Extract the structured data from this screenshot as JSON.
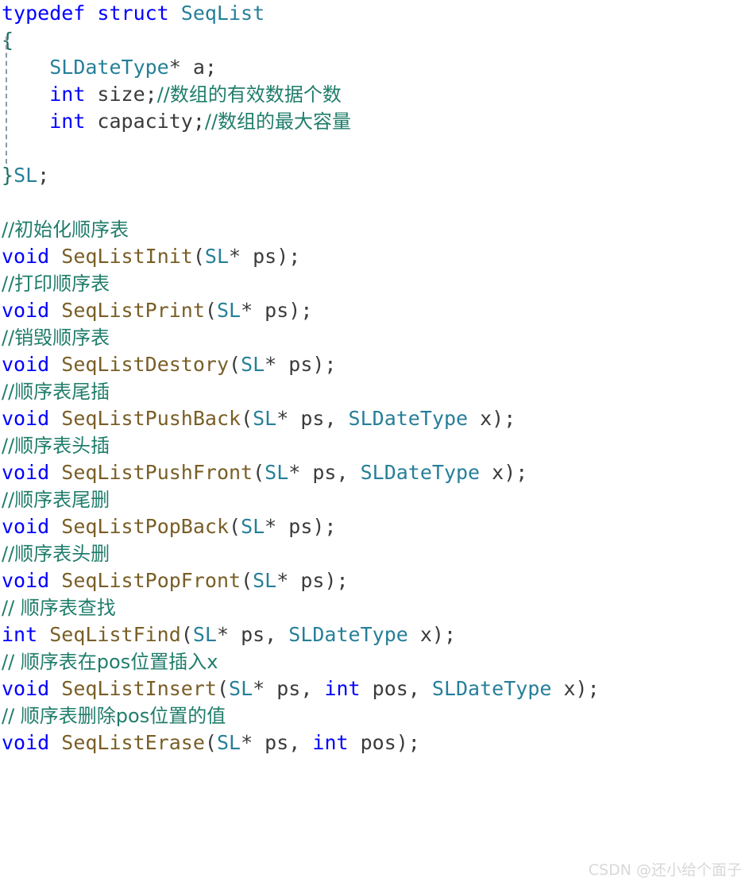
{
  "editor": {
    "language": "c",
    "background": "#ffffff",
    "colors": {
      "keyword": "#0000ff",
      "type": "#267f99",
      "function": "#795e26",
      "comment": "#207d6b",
      "punctuation": "#3b3b3b",
      "indent_guide": "#8a9aa5",
      "watermark": "#d8d8d8"
    },
    "indent_guide_visible": true
  },
  "code": {
    "lines": [
      {
        "id": "line-1",
        "text": "typedef struct SeqList",
        "tokens": [
          {
            "t": "typedef struct ",
            "c": "kw"
          },
          {
            "t": "SeqList",
            "c": "type"
          }
        ]
      },
      {
        "id": "line-2",
        "text": "{",
        "tokens": [
          {
            "t": "{",
            "c": "brace"
          }
        ]
      },
      {
        "id": "line-3",
        "text": "    SLDateType* a;",
        "tokens": [
          {
            "t": "    ",
            "c": "pun"
          },
          {
            "t": "SLDateType",
            "c": "type"
          },
          {
            "t": "* a;",
            "c": "pun"
          }
        ]
      },
      {
        "id": "line-4",
        "text": "    int size;//数组的有效数据个数",
        "tokens": [
          {
            "t": "    ",
            "c": "pun"
          },
          {
            "t": "int",
            "c": "kw"
          },
          {
            "t": " size;",
            "c": "pun"
          },
          {
            "t": "//数组的有效数据个数",
            "c": "cmt cn"
          }
        ]
      },
      {
        "id": "line-5",
        "text": "    int capacity;//数组的最大容量",
        "tokens": [
          {
            "t": "    ",
            "c": "pun"
          },
          {
            "t": "int",
            "c": "kw"
          },
          {
            "t": " capacity;",
            "c": "pun"
          },
          {
            "t": "//数组的最大容量",
            "c": "cmt cn"
          }
        ]
      },
      {
        "id": "line-6",
        "text": "",
        "tokens": []
      },
      {
        "id": "line-7",
        "text": "}SL;",
        "tokens": [
          {
            "t": "}",
            "c": "brace"
          },
          {
            "t": "SL",
            "c": "type"
          },
          {
            "t": ";",
            "c": "pun"
          }
        ]
      },
      {
        "id": "line-8",
        "text": "",
        "tokens": []
      },
      {
        "id": "line-9",
        "text": "//初始化顺序表",
        "tokens": [
          {
            "t": "//初始化顺序表",
            "c": "cmt cn"
          }
        ]
      },
      {
        "id": "line-10",
        "text": "void SeqListInit(SL* ps);",
        "tokens": [
          {
            "t": "void",
            "c": "kw"
          },
          {
            "t": " ",
            "c": "pun"
          },
          {
            "t": "SeqListInit",
            "c": "fn"
          },
          {
            "t": "(",
            "c": "pun"
          },
          {
            "t": "SL",
            "c": "type"
          },
          {
            "t": "* ps);",
            "c": "pun"
          }
        ]
      },
      {
        "id": "line-11",
        "text": "//打印顺序表",
        "tokens": [
          {
            "t": "//打印顺序表",
            "c": "cmt cn"
          }
        ]
      },
      {
        "id": "line-12",
        "text": "void SeqListPrint(SL* ps);",
        "tokens": [
          {
            "t": "void",
            "c": "kw"
          },
          {
            "t": " ",
            "c": "pun"
          },
          {
            "t": "SeqListPrint",
            "c": "fn"
          },
          {
            "t": "(",
            "c": "pun"
          },
          {
            "t": "SL",
            "c": "type"
          },
          {
            "t": "* ps);",
            "c": "pun"
          }
        ]
      },
      {
        "id": "line-13",
        "text": "//销毁顺序表",
        "tokens": [
          {
            "t": "//销毁顺序表",
            "c": "cmt cn"
          }
        ]
      },
      {
        "id": "line-14",
        "text": "void SeqListDestory(SL* ps);",
        "tokens": [
          {
            "t": "void",
            "c": "kw"
          },
          {
            "t": " ",
            "c": "pun"
          },
          {
            "t": "SeqListDestory",
            "c": "fn"
          },
          {
            "t": "(",
            "c": "pun"
          },
          {
            "t": "SL",
            "c": "type"
          },
          {
            "t": "* ps);",
            "c": "pun"
          }
        ]
      },
      {
        "id": "line-15",
        "text": "//顺序表尾插",
        "tokens": [
          {
            "t": "//顺序表尾插",
            "c": "cmt cn"
          }
        ]
      },
      {
        "id": "line-16",
        "text": "void SeqListPushBack(SL* ps, SLDateType x);",
        "tokens": [
          {
            "t": "void",
            "c": "kw"
          },
          {
            "t": " ",
            "c": "pun"
          },
          {
            "t": "SeqListPushBack",
            "c": "fn"
          },
          {
            "t": "(",
            "c": "pun"
          },
          {
            "t": "SL",
            "c": "type"
          },
          {
            "t": "* ps, ",
            "c": "pun"
          },
          {
            "t": "SLDateType",
            "c": "type"
          },
          {
            "t": " x);",
            "c": "pun"
          }
        ]
      },
      {
        "id": "line-17",
        "text": "//顺序表头插",
        "tokens": [
          {
            "t": "//顺序表头插",
            "c": "cmt cn"
          }
        ]
      },
      {
        "id": "line-18",
        "text": "void SeqListPushFront(SL* ps, SLDateType x);",
        "tokens": [
          {
            "t": "void",
            "c": "kw"
          },
          {
            "t": " ",
            "c": "pun"
          },
          {
            "t": "SeqListPushFront",
            "c": "fn"
          },
          {
            "t": "(",
            "c": "pun"
          },
          {
            "t": "SL",
            "c": "type"
          },
          {
            "t": "* ps, ",
            "c": "pun"
          },
          {
            "t": "SLDateType",
            "c": "type"
          },
          {
            "t": " x);",
            "c": "pun"
          }
        ]
      },
      {
        "id": "line-19",
        "text": "//顺序表尾删",
        "tokens": [
          {
            "t": "//顺序表尾删",
            "c": "cmt cn"
          }
        ]
      },
      {
        "id": "line-20",
        "text": "void SeqListPopBack(SL* ps);",
        "tokens": [
          {
            "t": "void",
            "c": "kw"
          },
          {
            "t": " ",
            "c": "pun"
          },
          {
            "t": "SeqListPopBack",
            "c": "fn"
          },
          {
            "t": "(",
            "c": "pun"
          },
          {
            "t": "SL",
            "c": "type"
          },
          {
            "t": "* ps);",
            "c": "pun"
          }
        ]
      },
      {
        "id": "line-21",
        "text": "//顺序表头删",
        "tokens": [
          {
            "t": "//顺序表头删",
            "c": "cmt cn"
          }
        ]
      },
      {
        "id": "line-22",
        "text": "void SeqListPopFront(SL* ps);",
        "tokens": [
          {
            "t": "void",
            "c": "kw"
          },
          {
            "t": " ",
            "c": "pun"
          },
          {
            "t": "SeqListPopFront",
            "c": "fn"
          },
          {
            "t": "(",
            "c": "pun"
          },
          {
            "t": "SL",
            "c": "type"
          },
          {
            "t": "* ps);",
            "c": "pun"
          }
        ]
      },
      {
        "id": "line-23",
        "text": "// 顺序表查找",
        "tokens": [
          {
            "t": "// 顺序表查找",
            "c": "cmt cn"
          }
        ]
      },
      {
        "id": "line-24",
        "text": "int SeqListFind(SL* ps, SLDateType x);",
        "tokens": [
          {
            "t": "int",
            "c": "kw"
          },
          {
            "t": " ",
            "c": "pun"
          },
          {
            "t": "SeqListFind",
            "c": "fn"
          },
          {
            "t": "(",
            "c": "pun"
          },
          {
            "t": "SL",
            "c": "type"
          },
          {
            "t": "* ps, ",
            "c": "pun"
          },
          {
            "t": "SLDateType",
            "c": "type"
          },
          {
            "t": " x);",
            "c": "pun"
          }
        ]
      },
      {
        "id": "line-25",
        "text": "// 顺序表在pos位置插入x",
        "tokens": [
          {
            "t": "// 顺序表在pos位置插入x",
            "c": "cmt cn"
          }
        ]
      },
      {
        "id": "line-26",
        "text": "void SeqListInsert(SL* ps, int pos, SLDateType x);",
        "tokens": [
          {
            "t": "void",
            "c": "kw"
          },
          {
            "t": " ",
            "c": "pun"
          },
          {
            "t": "SeqListInsert",
            "c": "fn"
          },
          {
            "t": "(",
            "c": "pun"
          },
          {
            "t": "SL",
            "c": "type"
          },
          {
            "t": "* ps, ",
            "c": "pun"
          },
          {
            "t": "int",
            "c": "kw"
          },
          {
            "t": " pos, ",
            "c": "pun"
          },
          {
            "t": "SLDateType",
            "c": "type"
          },
          {
            "t": " x);",
            "c": "pun"
          }
        ]
      },
      {
        "id": "line-27",
        "text": "// 顺序表删除pos位置的值",
        "tokens": [
          {
            "t": "// 顺序表删除pos位置的值",
            "c": "cmt cn"
          }
        ]
      },
      {
        "id": "line-28",
        "text": "void SeqListErase(SL* ps, int pos);",
        "tokens": [
          {
            "t": "void",
            "c": "kw"
          },
          {
            "t": " ",
            "c": "pun"
          },
          {
            "t": "SeqListErase",
            "c": "fn"
          },
          {
            "t": "(",
            "c": "pun"
          },
          {
            "t": "SL",
            "c": "type"
          },
          {
            "t": "* ps, ",
            "c": "pun"
          },
          {
            "t": "int",
            "c": "kw"
          },
          {
            "t": " pos);",
            "c": "pun"
          }
        ]
      }
    ]
  },
  "watermark": {
    "text": "CSDN @还小给个面子"
  }
}
